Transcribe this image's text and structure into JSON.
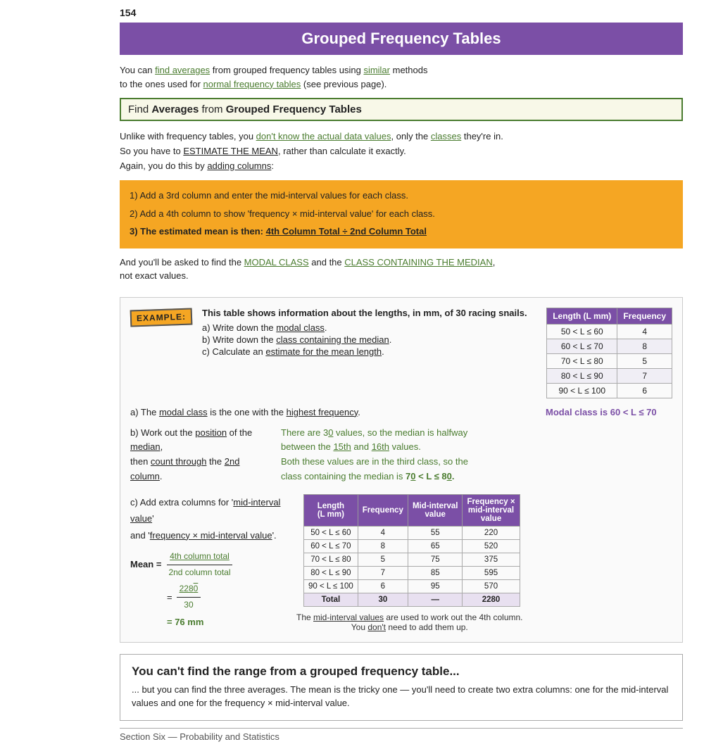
{
  "page": {
    "number": "154",
    "header": {
      "title": "Grouped Frequency Tables"
    },
    "intro": {
      "line1": "You can ",
      "link1": "find averages",
      "line1b": " from grouped frequency tables using ",
      "link2": "similar",
      "line1c": " methods",
      "line2": "to the ones used for ",
      "link3": "normal frequency tables",
      "line2b": " (see previous page)."
    },
    "find_averages_title": {
      "prefix": "Find ",
      "bold1": "Averages",
      "middle": " from ",
      "bold2": "Grouped Frequency Tables"
    },
    "body1": {
      "line1_pre": "Unlike with frequency tables, you ",
      "line1_link": "don't know the actual data values",
      "line1_post": ", only the ",
      "line1_link2": "classes",
      "line1_post2": " they're in.",
      "line2_pre": "So you have to ",
      "line2_link": "ESTIMATE THE MEAN",
      "line2_post": ", rather than calculate it exactly.",
      "line3_pre": "Again, you do this by ",
      "line3_link": "adding columns",
      "line3_post": ":"
    },
    "orange_steps": {
      "step1": "1)  Add a 3rd column and enter the mid-interval values for each class.",
      "step2": "2)  Add a 4th column to show 'frequency × mid-interval value' for each class.",
      "step3": "3)  The estimated mean is then: 4th Column Total ÷ 2nd Column Total"
    },
    "modal_text": {
      "pre": "And you'll be asked to find the ",
      "link1": "MODAL CLASS",
      "mid": " and the ",
      "link2": "CLASS CONTAINING THE MEDIAN",
      "post": ",",
      "line2": "not exact values."
    },
    "example": {
      "badge": "EXAMPLE:",
      "desc_bold": "This table shows information about the lengths, in mm, of 30 racing snails.",
      "questions": {
        "a": "a)  Write down the modal class.",
        "b": "b)  Write down the class containing the median.",
        "c": "c)  Calculate an estimate for the mean length."
      },
      "table": {
        "headers": [
          "Length (L mm)",
          "Frequency"
        ],
        "rows": [
          [
            "50 < L ≤ 60",
            "4"
          ],
          [
            "60 < L ≤ 70",
            "8"
          ],
          [
            "70 < L ≤ 80",
            "5"
          ],
          [
            "80 < L ≤ 90",
            "7"
          ],
          [
            "90 < L ≤ 100",
            "6"
          ]
        ]
      },
      "part_a": {
        "text_pre": "a)  The ",
        "text_link": "modal class",
        "text_mid": " is the one with the ",
        "text_link2": "highest frequency",
        "text_post": ".",
        "answer": "Modal class is 60 < L ≤ 70"
      },
      "part_b": {
        "left_line1": "b)  Work out the ",
        "left_link1": "position",
        "left_mid1": " of the ",
        "left_link2": "median",
        "left_post1": ",",
        "left_line2_pre": "then ",
        "left_link3": "count through",
        "left_line2_post": " the ",
        "left_link4": "2nd column",
        "left_post2": ".",
        "right_line1": "There are 3O values, so the median is halfway",
        "right_line2": "between the 15th and 16th values.",
        "right_line3": "Both these values are in the third class, so the",
        "right_line4": "class containing the median is 7O < L ≤ 8O."
      },
      "part_c": {
        "left_line1": "c)  Add extra columns for '",
        "left_link1": "mid-interval value",
        "left_post1": "'",
        "left_line2": "and '",
        "left_link2": "frequency × mid-interval value",
        "left_post2": "'.",
        "mean_label": "Mean =",
        "mean_num": "4th column total",
        "mean_den": "2nd column total",
        "mean_eq1": "2280",
        "mean_eq1_den": "30",
        "mean_eq2": "= 76 mm",
        "extended_table": {
          "headers": [
            "Length\n(L mm)",
            "Frequency",
            "Mid-interval\nvalue",
            "Frequency ×\nmid-interval\nvalue"
          ],
          "rows": [
            [
              "50 < L ≤ 60",
              "4",
              "55",
              "220"
            ],
            [
              "60 < L ≤ 70",
              "8",
              "65",
              "520"
            ],
            [
              "70 < L ≤ 80",
              "5",
              "75",
              "375"
            ],
            [
              "80 < L ≤ 90",
              "7",
              "85",
              "595"
            ],
            [
              "90 < L ≤ 100",
              "6",
              "95",
              "570"
            ]
          ],
          "total_row": [
            "Total",
            "30",
            "—",
            "2280"
          ]
        },
        "footnote_line1": "The mid-interval values are used to work out the 4th column.",
        "footnote_line2": "You don't need to add them up."
      }
    },
    "bottom_box": {
      "title": "You can't find the range from a grouped frequency table...",
      "text": "... but you can find the three averages.  The mean is the tricky one — you'll need to create two extra columns: one for the mid-interval values and one for the frequency × mid-interval value."
    },
    "footer": "Section Six — Probability and Statistics"
  }
}
